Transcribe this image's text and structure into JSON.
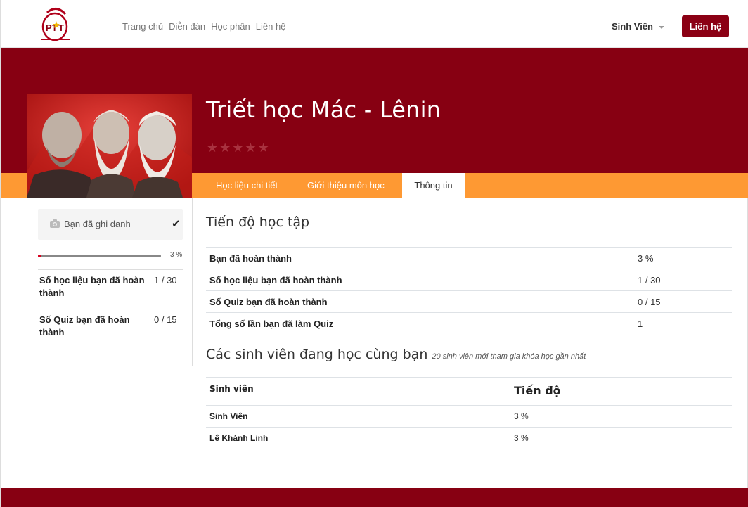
{
  "navbar": {
    "logo_text": "PTIT",
    "links": [
      "Trang chủ",
      "Diễn đàn",
      "Học phần",
      "Liên hệ"
    ],
    "user_label": "Sinh Viên",
    "contact_button": "Liên hệ"
  },
  "course": {
    "title": "Triết học Mác - Lênin",
    "rating_stars": 5,
    "tabs": [
      "Học liệu chi tiết",
      "Giới thiệu môn học",
      "Thông tin"
    ],
    "active_tab": "Thông tin"
  },
  "sidebar": {
    "enrolled_label": "Bạn đã ghi danh",
    "progress_percent": 3,
    "progress_text": "3 %",
    "stats": [
      {
        "label": "Số học liệu bạn đã hoàn thành",
        "value": "1 / 30"
      },
      {
        "label": "Số Quiz bạn đã hoàn thành",
        "value": "0 / 15"
      }
    ]
  },
  "progress_section": {
    "title": "Tiến độ học tập",
    "rows": [
      {
        "label": "Bạn đã hoàn thành",
        "value": "3 %"
      },
      {
        "label": "Số học liệu bạn đã hoàn thành",
        "value": "1 / 30"
      },
      {
        "label": "Số Quiz bạn đã hoàn thành",
        "value": "0 / 15"
      },
      {
        "label": "Tổng số lần bạn đã làm Quiz",
        "value": "1"
      }
    ]
  },
  "students_section": {
    "title": "Các sinh viên đang học cùng bạn",
    "subtitle": "20 sinh viên mới tham gia khóa học gần nhất",
    "headers": [
      "Sinh viên",
      "Tiến độ"
    ],
    "rows": [
      {
        "name": "Sinh Viên",
        "progress": "3 %"
      },
      {
        "name": "Lê Khánh Linh",
        "progress": "3 %"
      }
    ]
  },
  "colors": {
    "brand_red": "#870012",
    "tab_orange": "#fe9933",
    "button_red": "#8b0014"
  },
  "icons": [
    "camera-icon",
    "check-icon",
    "star-icon",
    "caret-down-icon"
  ]
}
